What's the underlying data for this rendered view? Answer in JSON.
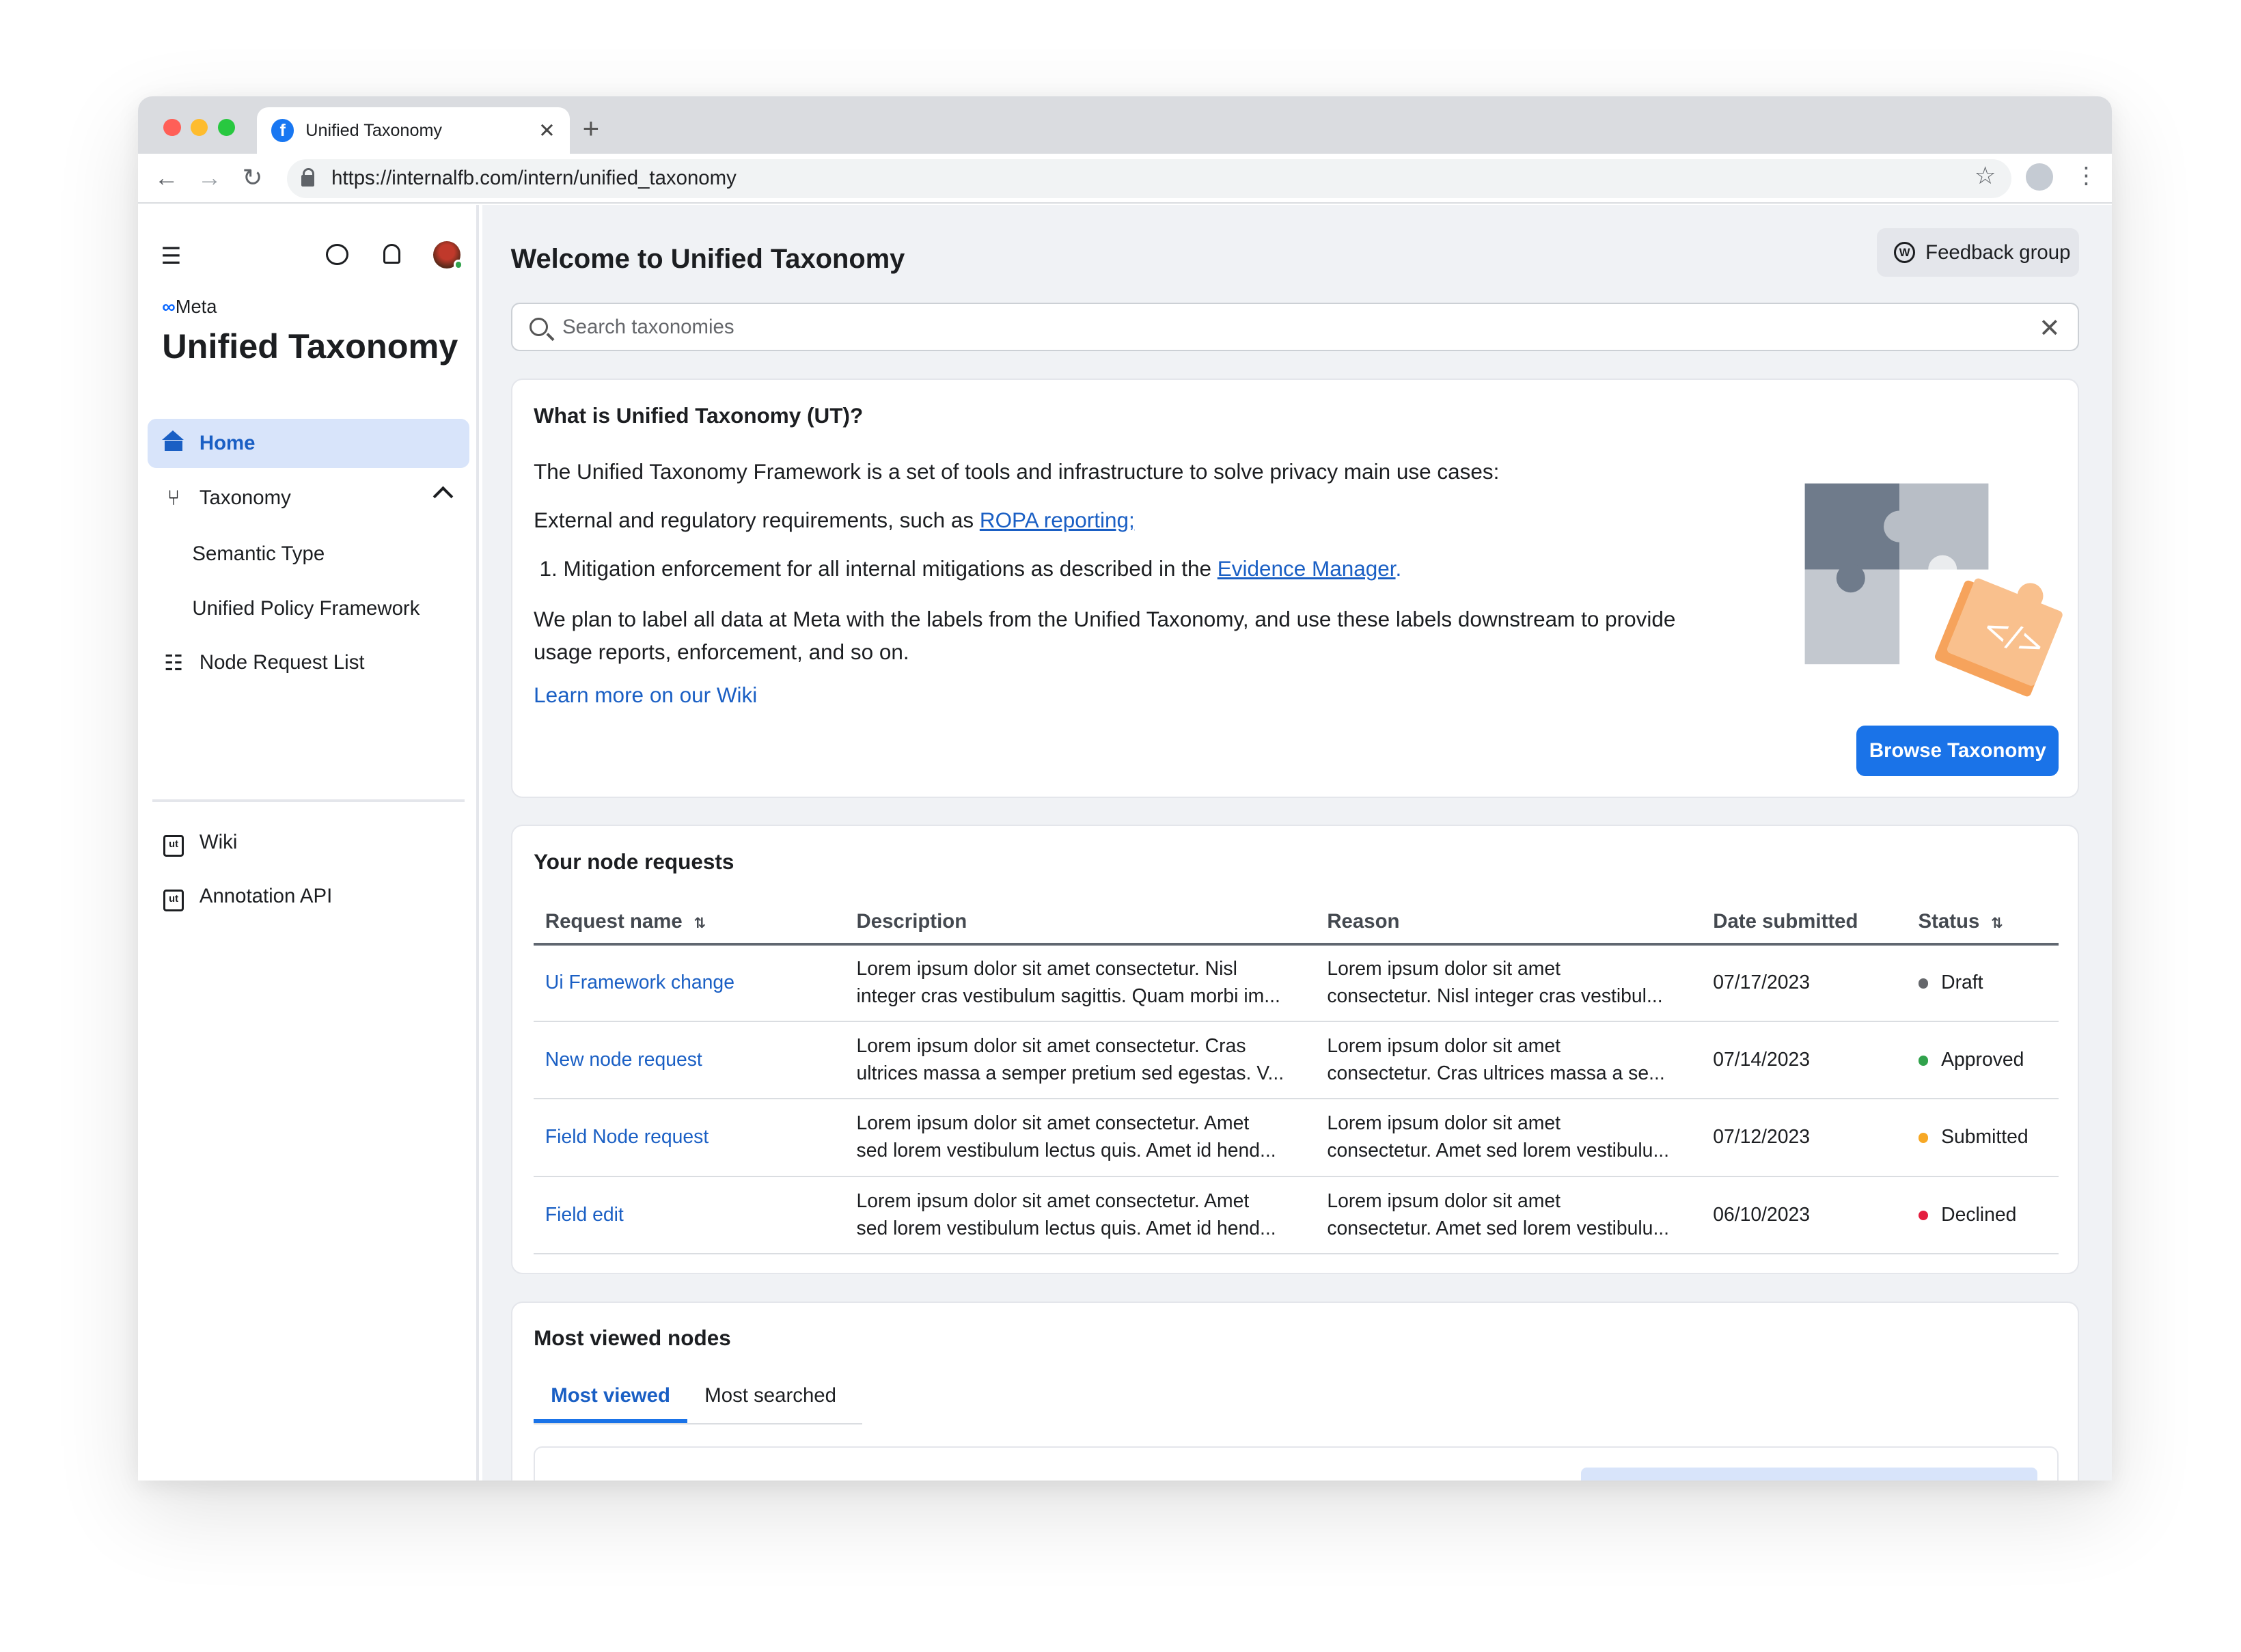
{
  "browser": {
    "tab_title": "Unified Taxonomy",
    "url": "https://internalfb.com/intern/unified_taxonomy"
  },
  "sidebar": {
    "brand": "Meta",
    "app_title": "Unified Taxonomy",
    "nav": {
      "home": "Home",
      "taxonomy": "Taxonomy",
      "semantic_type": "Semantic Type",
      "unified_policy_framework": "Unified Policy Framework",
      "node_request_list": "Node Request List",
      "wiki": "Wiki",
      "annotation_api": "Annotation API"
    }
  },
  "header": {
    "title": "Welcome to Unified Taxonomy",
    "feedback": "Feedback group"
  },
  "search": {
    "placeholder": "Search taxonomies"
  },
  "intro": {
    "title": "What is Unified Taxonomy (UT)?",
    "p1": "The Unified Taxonomy Framework is a set of tools and infrastructure to solve privacy main use cases:",
    "p2_prefix": "External and regulatory requirements, such as ",
    "p2_link": "ROPA reporting;",
    "li_num": "1.",
    "li_prefix": "Mitigation enforcement for all internal mitigations as described in the ",
    "li_link": "Evidence Manager",
    "li_suffix": ".",
    "p3": "We plan to label all data at Meta with the labels from the Unified Taxonomy, and use these labels downstream to provide usage reports, enforcement, and so on.",
    "wiki_link": "Learn more on our Wiki",
    "browse_button": "Browse Taxonomy"
  },
  "requests": {
    "title": "Your node requests",
    "columns": [
      "Request name",
      "Description",
      "Reason",
      "Date submitted",
      "Status"
    ],
    "rows": [
      {
        "name": "Ui Framework change",
        "desc1": "Lorem ipsum dolor sit amet consectetur. Nisl",
        "desc2": "integer cras vestibulum sagittis. Quam morbi im...",
        "reason1": "Lorem ipsum dolor sit amet",
        "reason2": "consectetur. Nisl integer cras vestibul...",
        "date": "07/17/2023",
        "status": "Draft",
        "status_color": "#65676b"
      },
      {
        "name": "New node request",
        "desc1": "Lorem ipsum dolor sit amet consectetur. Cras",
        "desc2": "ultrices massa a semper pretium sed egestas. V...",
        "reason1": "Lorem ipsum dolor sit amet",
        "reason2": "consectetur. Cras ultrices massa a se...",
        "date": "07/14/2023",
        "status": "Approved",
        "status_color": "#31a24c"
      },
      {
        "name": "Field Node request",
        "desc1": "Lorem ipsum dolor sit amet consectetur. Amet",
        "desc2": "sed lorem vestibulum lectus quis. Amet id hend...",
        "reason1": "Lorem ipsum dolor sit amet",
        "reason2": "consectetur. Amet sed lorem vestibulu...",
        "date": "07/12/2023",
        "status": "Submitted",
        "status_color": "#f7a825"
      },
      {
        "name": "Field edit",
        "desc1": "Lorem ipsum dolor sit amet consectetur. Amet",
        "desc2": "sed lorem vestibulum lectus quis. Amet id hend...",
        "reason1": "Lorem ipsum dolor sit amet",
        "reason2": "consectetur. Amet sed lorem vestibulu...",
        "date": "06/10/2023",
        "status": "Declined",
        "status_color": "#e41e3f"
      }
    ]
  },
  "most_viewed": {
    "title": "Most viewed nodes",
    "tabs": [
      "Most viewed",
      "Most searched"
    ]
  }
}
